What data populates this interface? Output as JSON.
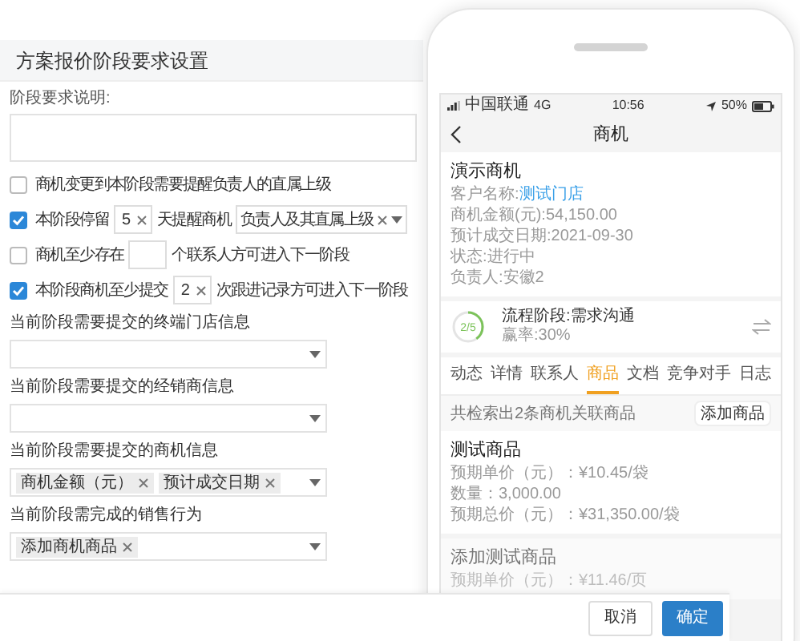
{
  "panel": {
    "title": "方案报价阶段要求设置",
    "description_label": "阶段要求说明:",
    "rules": [
      {
        "kind": "plain",
        "checked": false,
        "label": "商机变更到本阶段需要提醒负责人的直属上级"
      },
      {
        "kind": "input",
        "checked": true,
        "label": "本阶段停留",
        "input": "5",
        "suffix": "天提醒商机",
        "select": "负责人及其直属上级"
      },
      {
        "kind": "input",
        "checked": false,
        "label": "商机至少存在",
        "suffix": "个联系人方可进入下一阶段"
      },
      {
        "kind": "input",
        "checked": true,
        "label": "本阶段商机至少提交",
        "input": "2",
        "suffix": "次跟进记录方可进入下一阶段"
      }
    ],
    "sections": [
      {
        "label": "当前阶段需要提交的终端门店信息"
      },
      {
        "label": "当前阶段需要提交的经销商信息"
      },
      {
        "label": "当前阶段需要提交的商机信息",
        "tags": [
          "商机金额（元）",
          "预计成交日期"
        ]
      },
      {
        "label": "当前阶段需完成的销售行为",
        "tags": [
          "添加商机商品"
        ]
      }
    ]
  },
  "phone": {
    "status": {
      "carrier": "中国联通",
      "network": "4G",
      "time": "10:56",
      "battery": "50%"
    },
    "nav_title": "商机",
    "record": {
      "title": "演示商机",
      "fields": [
        {
          "label": "客户名称:",
          "value": "测试门店",
          "kind": "link"
        },
        {
          "label": "商机金额(元):",
          "value": "54,150.00",
          "kind": "plain"
        },
        {
          "label": "预计成交日期:",
          "value": "2021-09-30",
          "kind": "plain"
        },
        {
          "label": "状态:",
          "value": "进行中",
          "kind": "plain"
        },
        {
          "label": "负责人:",
          "value": "安徽2",
          "kind": "plain"
        }
      ]
    },
    "stage": {
      "progress": "2/5",
      "level": 0.4,
      "name": "流程阶段:需求沟通",
      "win_rate": "赢率:30%"
    },
    "tabs": [
      {
        "label": "动态",
        "selected": false
      },
      {
        "label": "详情",
        "selected": false
      },
      {
        "label": "联系人",
        "selected": false
      },
      {
        "label": "商品",
        "selected": true
      },
      {
        "label": "文档",
        "selected": false
      },
      {
        "label": "竞争对手",
        "selected": false
      },
      {
        "label": "日志",
        "selected": false
      }
    ],
    "summary": "共检索出2条商机关联商品",
    "add_button": "添加商品",
    "products": [
      {
        "name": "测试商品",
        "lines": [
          "预期单价（元）：¥10.45/袋",
          "数量：3,000.00",
          "预期总价（元）：¥31,350.00/袋"
        ]
      },
      {
        "name": "添加测试商品",
        "lines": [
          "预期单价（元）：¥11.46/页"
        ]
      }
    ]
  },
  "footer": {
    "buttons": [
      {
        "label": "取消",
        "kind": "secondary"
      },
      {
        "label": "确定",
        "kind": "primary"
      }
    ]
  }
}
